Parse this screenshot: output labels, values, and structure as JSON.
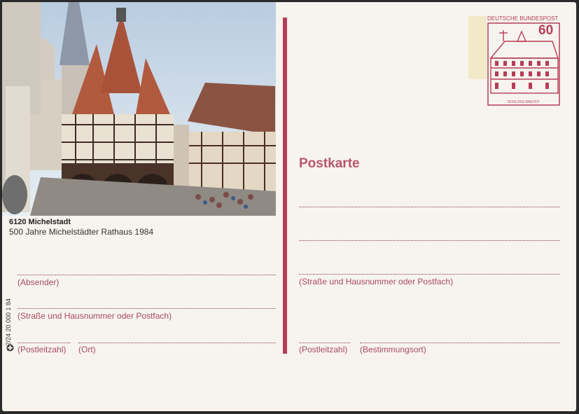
{
  "left": {
    "caption_title": "6120 Michelstadt",
    "caption_sub": "500 Jahre Michelstädter Rathaus 1984",
    "sender_label": "(Absender)",
    "street_label": "(Straße und Hausnummer oder Postfach)",
    "postcode_label": "(Postleitzahl)",
    "city_label": "(Ort)",
    "print_code": "n 2/24 20 000 1 84"
  },
  "right": {
    "postkarte": "Postkarte",
    "street_label": "(Straße und Hausnummer oder Postfach)",
    "postcode_label": "(Postleitzahl)",
    "destination_label": "(Bestimmungsort)"
  },
  "stamp": {
    "label": "DEUTSCHE BUNDESPOST",
    "value": "60",
    "caption": "SCHLOSS RHEYDT"
  },
  "colors": {
    "accent": "#b73d57",
    "card": "#f7f4ef"
  }
}
